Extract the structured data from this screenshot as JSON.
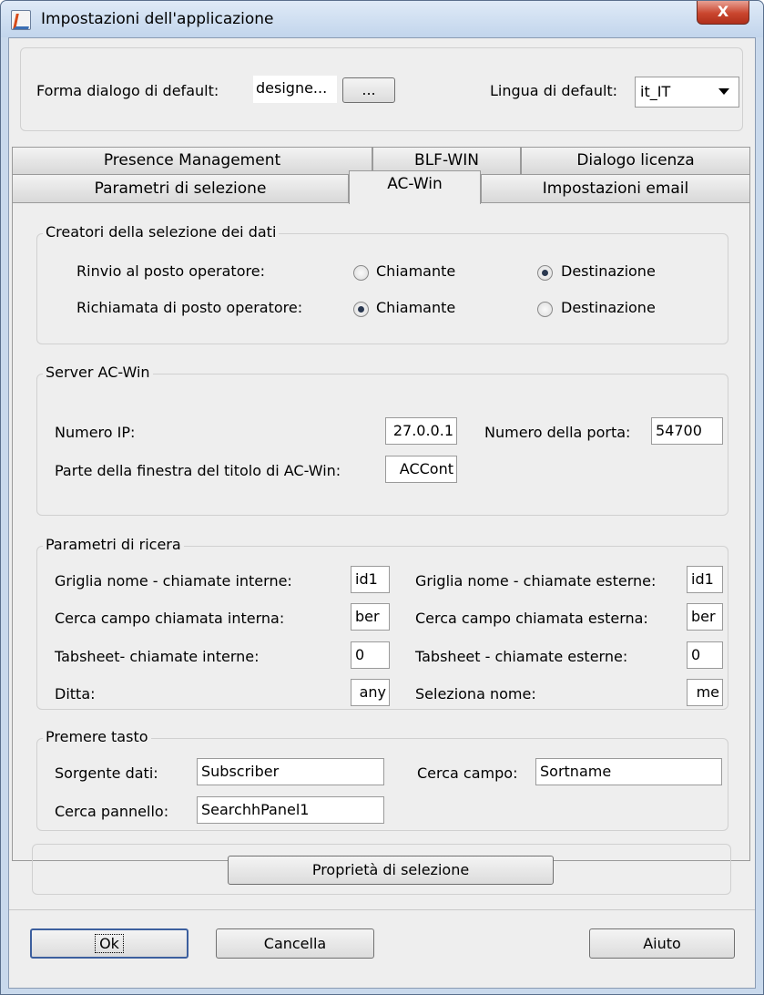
{
  "window": {
    "title": "Impostazioni dell'applicazione",
    "close_glyph": "X"
  },
  "top": {
    "dialog_label": "Forma dialogo di default:",
    "dialog_value": "designe...",
    "browse_label": "...",
    "lang_label": "Lingua di default:",
    "lang_value": "it_IT"
  },
  "tabs": {
    "row1": [
      "Presence Management",
      "BLF-WIN",
      "Dialogo licenza"
    ],
    "row2": [
      "Parametri di selezione",
      "AC-Win",
      "Impostazioni email"
    ],
    "selected": "AC-Win"
  },
  "creators": {
    "title": "Creatori della selezione dei dati",
    "rows": [
      {
        "label": "Rinvio al posto operatore:",
        "opt1": "Chiamante",
        "opt2": "Destinazione",
        "selected": "Destinazione"
      },
      {
        "label": "Richiamata di posto operatore:",
        "opt1": "Chiamante",
        "opt2": "Destinazione",
        "selected": "Chiamante"
      }
    ]
  },
  "server": {
    "title": "Server AC-Win",
    "ip_label": "Numero IP:",
    "ip_value": "27.0.0.1",
    "port_label": "Numero della porta:",
    "port_value": "54700",
    "wintitle_label": "Parte della finestra del titolo di AC-Win:",
    "wintitle_value": "ACCont"
  },
  "search": {
    "title": "Parametri di ricera",
    "left": [
      {
        "label": "Griglia nome - chiamate interne:",
        "value": "id1"
      },
      {
        "label": "Cerca campo chiamata interna:",
        "value": "ber"
      },
      {
        "label": "Tabsheet- chiamate interne:",
        "value": "0"
      },
      {
        "label": "Ditta:",
        "value": "any"
      }
    ],
    "right": [
      {
        "label": "Griglia nome - chiamate esterne:",
        "value": "id1"
      },
      {
        "label": "Cerca campo chiamata esterna:",
        "value": "ber"
      },
      {
        "label": "Tabsheet - chiamate esterne:",
        "value": "0"
      },
      {
        "label": "Seleziona nome:",
        "value": "me"
      }
    ]
  },
  "keypress": {
    "title": "Premere tasto",
    "source_label": "Sorgente dati:",
    "source_value": "Subscriber",
    "field_label": "Cerca campo:",
    "field_value": "Sortname",
    "panel_label": "Cerca pannello:",
    "panel_value": "SearchhPanel1"
  },
  "props_button": "Proprietà di selezione",
  "footer": {
    "ok": "Ok",
    "cancel": "Cancella",
    "help": "Aiuto"
  }
}
